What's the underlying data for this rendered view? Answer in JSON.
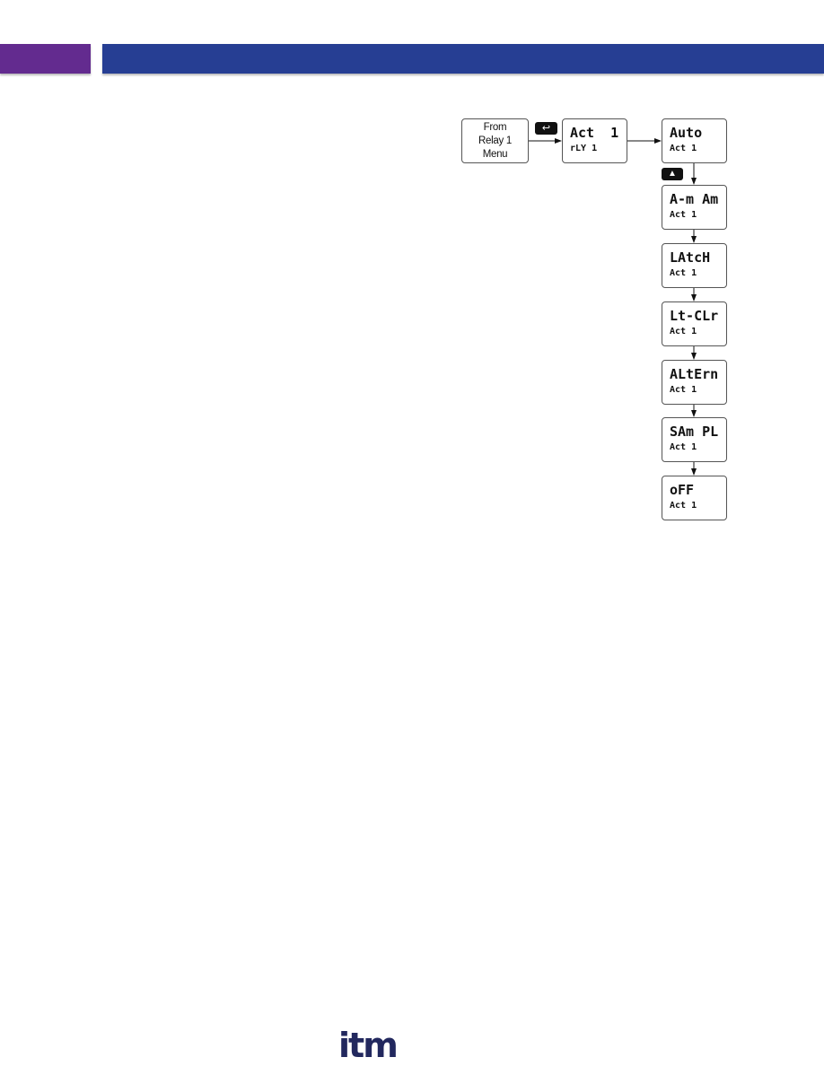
{
  "header": {
    "tab_color": "#632b8f",
    "bar_color": "#263e93"
  },
  "diagram": {
    "from_box": {
      "line1": "From",
      "line2": "Relay 1",
      "line3": "Menu"
    },
    "enter_key": {
      "icon": "enter-icon",
      "glyph": "↩"
    },
    "up_key": {
      "icon": "up-arrow-icon",
      "glyph": "▲"
    },
    "act_box": {
      "top": "Act  1",
      "bottom": "rLY 1"
    },
    "options": [
      {
        "top": "Auto",
        "bottom": "Act 1"
      },
      {
        "top": "A-m Am",
        "bottom": "Act 1"
      },
      {
        "top": "LAtcH",
        "bottom": "Act 1"
      },
      {
        "top": "Lt-CLr",
        "bottom": "Act 1"
      },
      {
        "top": "ALtErn",
        "bottom": "Act 1"
      },
      {
        "top": "SAm PL",
        "bottom": "Act 1"
      },
      {
        "top": "oFF",
        "bottom": "Act 1"
      }
    ]
  },
  "footer": {
    "logo": "itm"
  }
}
